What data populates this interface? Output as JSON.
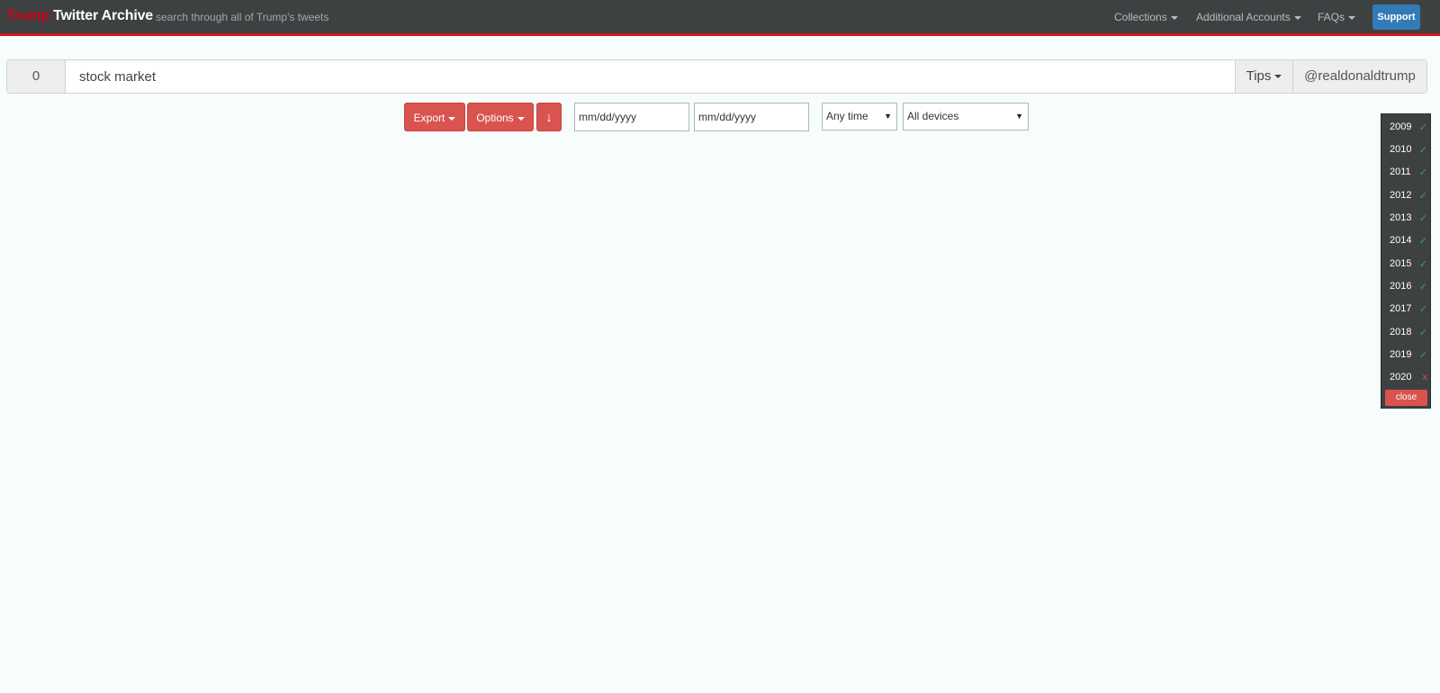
{
  "nav": {
    "brand_red": "Trump",
    "brand_white": "Twitter Archive",
    "tagline": "search through all of Trump's tweets",
    "collections": "Collections",
    "additional_accounts": "Additional Accounts",
    "faqs": "FAQs",
    "support": "Support"
  },
  "search": {
    "count": "0",
    "query": "stock market",
    "tips": "Tips",
    "account": "@realdonaldtrump"
  },
  "controls": {
    "export": "Export",
    "options": "Options",
    "sort_arrow": "↓",
    "start_date_placeholder": "mm/dd/yyyy",
    "end_date_placeholder": "mm/dd/yyyy",
    "time_filter": "Any time",
    "device_filter": "All devices"
  },
  "years": [
    {
      "year": "2009",
      "status": "✓"
    },
    {
      "year": "2010",
      "status": "✓"
    },
    {
      "year": "2011",
      "status": "✓"
    },
    {
      "year": "2012",
      "status": "✓"
    },
    {
      "year": "2013",
      "status": "✓"
    },
    {
      "year": "2014",
      "status": "✓"
    },
    {
      "year": "2015",
      "status": "✓"
    },
    {
      "year": "2016",
      "status": "✓"
    },
    {
      "year": "2017",
      "status": "✓"
    },
    {
      "year": "2018",
      "status": "✓"
    },
    {
      "year": "2019",
      "status": "✓"
    },
    {
      "year": "2020",
      "status": "x"
    }
  ],
  "year_panel": {
    "close": "close"
  },
  "colors": {
    "navbar": "#3e4142",
    "accent_red": "#d9534f",
    "support_blue": "#337ab7",
    "check_green": "#2fa84f"
  }
}
